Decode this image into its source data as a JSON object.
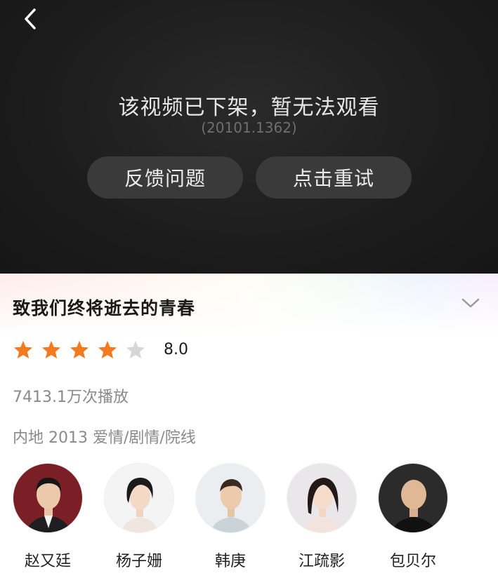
{
  "player": {
    "back_icon": "chevron-left-icon",
    "message": "该视频已下架，暂无法观看",
    "error_code": "(20101.1362)",
    "feedback_label": "反馈问题",
    "retry_label": "点击重试"
  },
  "info": {
    "title": "致我们终将逝去的青春",
    "expand_icon": "chevron-down-icon",
    "rating": {
      "stars_filled": 4,
      "stars_total": 5,
      "score": "8.0"
    },
    "plays": "7413.1万次播放",
    "meta": "内地 2013 爱情/剧情/院线",
    "cast": [
      {
        "name": "赵又廷"
      },
      {
        "name": "杨子姗"
      },
      {
        "name": "韩庚"
      },
      {
        "name": "江疏影"
      },
      {
        "name": "包贝尔"
      }
    ]
  },
  "colors": {
    "star_filled": "#f57a1f",
    "star_empty": "#d6d6d6",
    "player_bg": "#1c1c1c",
    "player_button": "#3a3a3a"
  }
}
